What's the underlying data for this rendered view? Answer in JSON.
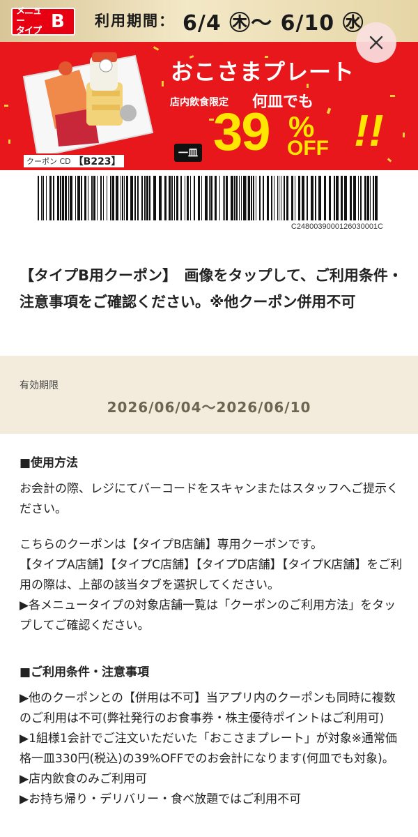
{
  "banner": {
    "menu_badge_label": "メニュー\nタイプ",
    "menu_badge_type": "B",
    "period_label": "利用期間：",
    "period_dates": "6/4 ㊍〜 6/10 ㊌",
    "title": "おこさまプレート",
    "dine_in": "店内飲食限定",
    "any_count": "何皿でも",
    "per_plate": "一皿",
    "discount_number": "39",
    "discount_percent": "%",
    "discount_off": "OFF",
    "exclaim": "!!",
    "coupon_cd_label": "クーポン CD",
    "coupon_cd_code": "【B223】",
    "close_icon": "close-icon"
  },
  "barcode": {
    "number": "C2480039000126030001C"
  },
  "description": "【タイプB用クーポン】　画像をタップして、ご利用条件・注意事項をご確認ください。※他クーポン併用不可",
  "validity": {
    "label": "有効期限",
    "range": "2026/06/04〜2026/06/10"
  },
  "usage": {
    "heading": "■使用方法",
    "p1": "お会計の際、レジにてバーコードをスキャンまたはスタッフへご提示ください。",
    "p2": "こちらのクーポンは【タイプB店舗】専用クーポンです。\n【タイプA店舗】【タイプC店舗】【タイプD店舗】【タイプK店舗】をご利用の際は、上部の該当タブを選択してください。\n▶各メニュータイプの対象店舗一覧は「クーポンのご利用方法」をタップしてご確認ください。"
  },
  "conditions": {
    "heading": "■ご利用条件・注意事項",
    "body": "▶他のクーポンとの【併用は不可】当アプリ内のクーポンも同時に複数のご利用は不可(弊社発行のお食事券・株主優待ポイントはご利用可)\n▶1組様1会計でご注文いただいた「おこさまプレート」が対象※通常価格一皿330円(税込)の39%OFFでのお会計になります(何皿でも対象)。\n▶店内飲食のみご利用可\n▶お持ち帰り・デリバリー・食べ放題ではご利用不可"
  },
  "colors": {
    "brand_red": "#e8171b",
    "discount_yellow": "#ffe600",
    "validity_bg": "#f3ecdd"
  }
}
